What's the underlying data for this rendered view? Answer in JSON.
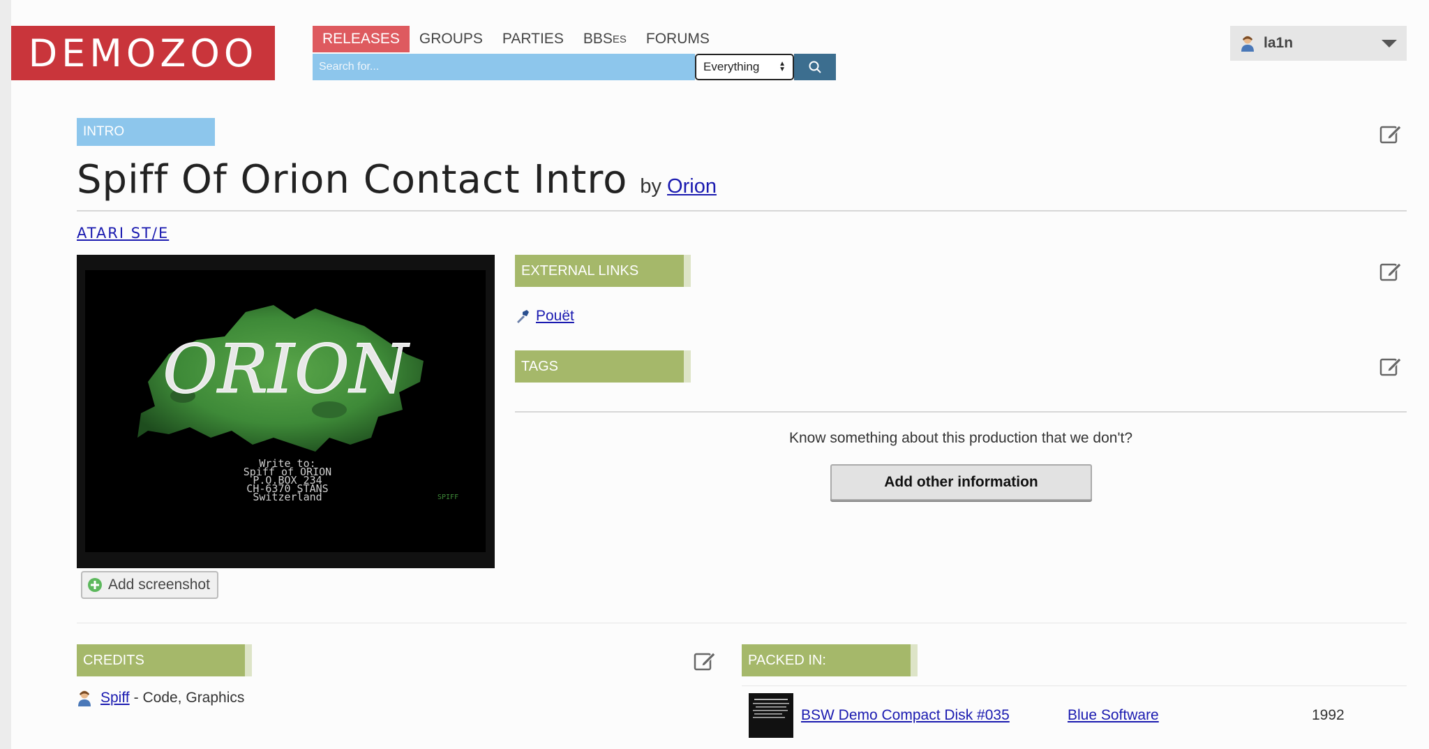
{
  "header": {
    "logo_text": "DEMOZOO",
    "nav": [
      {
        "label": "RELEASES",
        "active": true
      },
      {
        "label": "GROUPS",
        "active": false
      },
      {
        "label": "PARTIES",
        "active": false
      },
      {
        "label": "FORUMS",
        "active": false
      }
    ],
    "nav_bbs_prefix": "BBS",
    "nav_bbs_suffix": "ES",
    "search": {
      "placeholder": "Search for...",
      "scope": "Everything"
    },
    "user": {
      "name": "la1n"
    }
  },
  "production": {
    "type": "INTRO",
    "title": "Spiff Of Orion Contact Intro",
    "by_label": "by",
    "author": "Orion",
    "platform": "ATARI ST/E"
  },
  "screenshot": {
    "logo_text": "ORION",
    "caption_lines": [
      "Write to:",
      "Spiff of ORION",
      "P.O.BOX 234",
      "CH-6370 STANS",
      "Switzerland"
    ],
    "signature": "SPIFF",
    "add_label": "Add screenshot"
  },
  "external_links": {
    "heading": "EXTERNAL LINKS",
    "links": [
      {
        "label": "Pouët"
      }
    ]
  },
  "tags": {
    "heading": "TAGS"
  },
  "more_info": {
    "prompt": "Know something about this production that we don't?",
    "button": "Add other information"
  },
  "credits": {
    "heading": "CREDITS",
    "items": [
      {
        "name": "Spiff",
        "roles": "- Code, Graphics"
      }
    ]
  },
  "packed_in": {
    "heading": "PACKED IN:",
    "items": [
      {
        "title": "BSW Demo Compact Disk #035",
        "group": "Blue Software",
        "year": "1992"
      }
    ]
  },
  "colors": {
    "logo_red": "#c9353b",
    "nav_active": "#de5a5f",
    "search_blue": "#8dc6ec",
    "search_button": "#3c6e8f",
    "section_green": "#a5b86a",
    "link": "#1a1ab0"
  }
}
